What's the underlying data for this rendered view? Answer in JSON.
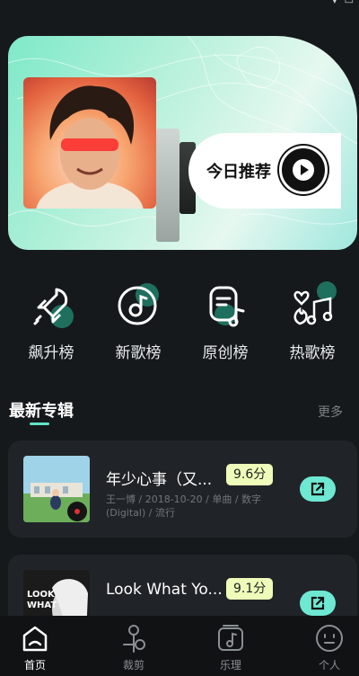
{
  "banner": {
    "recommend_label": "今日推荐",
    "accent_color": "#7ee9c8"
  },
  "categories": [
    {
      "label": "飙升榜",
      "icon": "rocket-icon"
    },
    {
      "label": "新歌榜",
      "icon": "vinyl-disc-icon"
    },
    {
      "label": "原创榜",
      "icon": "note-document-icon"
    },
    {
      "label": "热歌榜",
      "icon": "hot-music-icon"
    }
  ],
  "section": {
    "title": "最新专辑",
    "more_label": "更多"
  },
  "albums": [
    {
      "title": "年少心事（又...",
      "meta": "王一博 / 2018-10-20 / 单曲 / 数字(Digital) / 流行",
      "score": "9.6分"
    },
    {
      "title": "Look What Yo...",
      "meta": "",
      "score": "9.1分"
    }
  ],
  "nav": [
    {
      "label": "首页",
      "icon": "home-icon",
      "active": true
    },
    {
      "label": "裁剪",
      "icon": "scissors-icon",
      "active": false
    },
    {
      "label": "乐理",
      "icon": "music-theory-icon",
      "active": false
    },
    {
      "label": "个人",
      "icon": "profile-face-icon",
      "active": false
    }
  ],
  "colors": {
    "background": "#16191c",
    "card": "#202428",
    "accent": "#5fe3c6",
    "score_badge": "#eefbb9"
  }
}
